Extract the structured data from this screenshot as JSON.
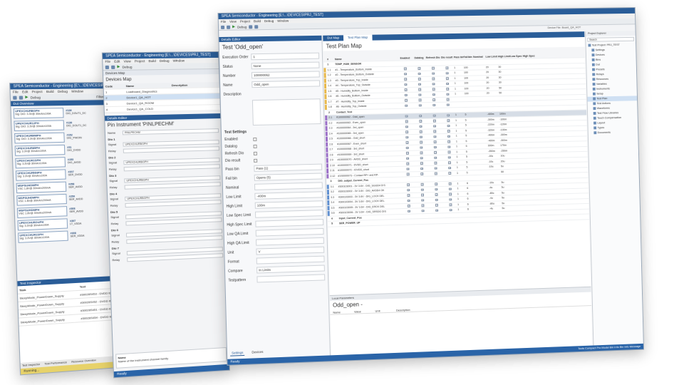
{
  "win1": {
    "title": "SPEA Semiconductor - Engineering [E:\\...\\DEVICES\\PRJ_TEST]",
    "menu": [
      "File",
      "Edit",
      "Project",
      "Build",
      "Debug",
      "Window"
    ],
    "debug_label": "Debug",
    "filter_label": "Filter For Active",
    "panel_title": "Dut Overview",
    "devices": [
      {
        "name": "UPEXCHURBGPH",
        "spec": "Sig: DIO: 3.3V@ 30mA/±100A",
        "pin": "#136",
        "pin_name": "DIG_DOUT1_DC"
      },
      {
        "name": "UPEXCHUR12PH",
        "spec": "Sig: DIO: 3.3V@ 30mA/±100A",
        "pin": "#136",
        "pin_name": "DIG_DOUT1_DC"
      },
      {
        "name": "UPEXCHURMMPH",
        "spec": "Sig: DIO: 3.3V@ 30mA/±100A",
        "pin": "#152",
        "pin_name": "DIG_PWOIN"
      },
      {
        "name": "UPEXCHUR85PH",
        "spec": "Sig: 3.3V@ 30mA/±100A",
        "pin": "#31",
        "pin_name": "DIG_DVDD"
      },
      {
        "name": "UPEXCHUR1SPH",
        "spec": "Sig: 3.3V@ 30mA/±100A",
        "pin": "#153",
        "pin_name": "DIG_AVDD"
      },
      {
        "name": "UPEXCHURNNPH",
        "spec": "Sig: 3.3V@ 30mA/±100A",
        "pin": "#207",
        "pin_name": "SER_DVDD"
      },
      {
        "name": "MSPSUHDMPH",
        "spec": "VSC 1.8V@ 30mA/±200mA",
        "pin": "#258",
        "pin_name": "SER_AVDD"
      },
      {
        "name": "MSPSUHDMPH",
        "spec": "VSC 1.8V@ 30mA/±200mA",
        "pin": "#259",
        "pin_name": "SER_AVDD"
      },
      {
        "name": "MSPSUHDMPH",
        "spec": "VSC 1.8V@ 30mA/±200mA",
        "pin": "#308",
        "pin_name": "SER_AVDD"
      },
      {
        "name": "UPEXCHURGUPH",
        "spec": "Sig: 3.3V@ 30mA/±100A",
        "pin": "#307",
        "pin_name": "LT_VDDA"
      },
      {
        "name": "UPEXCHUR1SPH",
        "spec": "Sig: 3.3V@ 30mA/±100A",
        "pin": "#308",
        "pin_name": "SER_VDDA"
      }
    ],
    "inspector_title": "Test Inspector",
    "inspector_cols": [
      "Task",
      "Test"
    ],
    "inspector_rows": [
      {
        "task": "SleepMode_PowerDown_Supply",
        "test": "#30028S453 - DVDD IDDC Ma..."
      },
      {
        "task": "SleepMode_PowerDown_Supply",
        "test": "#30028S452 - DVDD IDDC Ma..."
      },
      {
        "task": "SleepMode_PowerDown_Supply",
        "test": "#30028S451 - DVDD IDDC Ma..."
      },
      {
        "task": "SleepMode_PowerDown_Supply",
        "test": "#30028S454 - DVDD IDDC Ma..."
      }
    ],
    "bottom_tabs": [
      "Test Inspector",
      "Test Performance",
      "Resource Overview"
    ],
    "status": "Running..."
  },
  "win2": {
    "title": "SPEA Semiconductor - Engineering [E:\\...\\DEVICES\\PRJ_TEST]",
    "menu": [
      "File",
      "Edit",
      "View",
      "Project",
      "Build",
      "Debug",
      "Window"
    ],
    "debug_label": "Debug",
    "tab_label": "Devices Map",
    "map_title": "Devices Map",
    "map_cols": [
      "Code",
      "Name",
      "Description"
    ],
    "map_rows": [
      {
        "code": "1",
        "name": "Loadboard_Diagnostics",
        "desc": ""
      },
      {
        "code": "2",
        "name": "Device1_QA_HOT",
        "desc": ""
      },
      {
        "code": "3",
        "name": "Device1_QA_ROOM",
        "desc": ""
      },
      {
        "code": "4",
        "name": "Device1_QA_COLD",
        "desc": ""
      }
    ],
    "details_head": "Details Editor",
    "pin_title": "Pin Instrument 'PINLPECHM'",
    "name_label": "Name",
    "name_value": "PINLPECHM",
    "dios": [
      {
        "title": "Dio 1",
        "signal": "UPEXCHURBGPH",
        "relay": ""
      },
      {
        "title": "Dio 2",
        "signal": "UPEXCHURBGPH",
        "relay": ""
      },
      {
        "title": "Dio 3",
        "signal": "UPEXCHURBGPH",
        "relay": ""
      },
      {
        "title": "Dio 4",
        "signal": "UPEXCHURBGPH",
        "relay": ""
      },
      {
        "title": "Dio 5",
        "signal": "",
        "relay": ""
      },
      {
        "title": "Dio 6",
        "signal": "",
        "relay": ""
      },
      {
        "title": "Dio 7",
        "signal": "",
        "relay": ""
      },
      {
        "title": "Dio 8",
        "signal": "",
        "relay": ""
      },
      {
        "title": "Dio 9",
        "signal": "",
        "relay": ""
      }
    ],
    "signal_label": "Signal",
    "relay_label": "Relay",
    "desc_label": "Name",
    "desc_text": "Name of the instrument channel family",
    "status": "Ready"
  },
  "win3": {
    "title": "SPEA Semiconductor - Engineering [E:\\...\\DEVICES\\PRJ_TEST]",
    "menu": [
      "File",
      "View",
      "Project",
      "Build",
      "Debug",
      "Window"
    ],
    "debug_label": "Debug",
    "device_file": "Device File: Board_QA_HOT",
    "details_head": "Details Editor",
    "test_title": "Test 'Odd_open'",
    "fields": [
      {
        "label": "Execution Order",
        "value": "1"
      },
      {
        "label": "Status",
        "value": "None"
      },
      {
        "label": "Number",
        "value": "100000062"
      },
      {
        "label": "Name",
        "value": "Odd_open"
      },
      {
        "label": "Description",
        "value": ""
      }
    ],
    "settings_label": "Test Settings",
    "checks": [
      "Enabled",
      "Datalog",
      "Refresh Dio",
      "Dio result"
    ],
    "settings": [
      {
        "label": "Pass bin",
        "value": "Pass (1)"
      },
      {
        "label": "Fail bin",
        "value": "Opens (5)"
      },
      {
        "label": "Nominal",
        "value": ""
      },
      {
        "label": "Low Limit",
        "value": "-400m"
      },
      {
        "label": "High Limit",
        "value": "100m"
      },
      {
        "label": "Low Spec Limit",
        "value": ""
      },
      {
        "label": "High Spec Limit",
        "value": ""
      },
      {
        "label": "Low QA Limit",
        "value": ""
      },
      {
        "label": "High QA Limit",
        "value": ""
      },
      {
        "label": "Unit",
        "value": "V"
      },
      {
        "label": "Format",
        "value": ""
      },
      {
        "label": "Compare",
        "value": "In Limits"
      },
      {
        "label": "Testpattern",
        "value": ""
      }
    ],
    "det_tabs": [
      "Settings",
      "Devices"
    ],
    "doc_tabs": [
      "Dut Map",
      "Test Plan Map"
    ],
    "plan_title": "Test Plan Map",
    "grid_headers": [
      "#",
      "Name",
      "Enabled",
      "Datalog",
      "Refresh Dio",
      "Dio result",
      "Pass bin",
      "Fail bin",
      "Nominal",
      "Low Limit",
      "High Limit",
      "Low Spec Limit",
      "High Spec Limit"
    ],
    "grid_rows": [
      {
        "num": "1",
        "name": "TEMP_HUM_SENSOR",
        "group": true,
        "color": "",
        "vals": [
          "",
          "",
          "",
          "",
          ""
        ]
      },
      {
        "num": "1.1",
        "name": "#1 - Temperature_Bottom_Inside",
        "group": false,
        "color": "#e8b84a",
        "vals": [
          "1",
          "100",
          "",
          "20",
          "30"
        ]
      },
      {
        "num": "1.2",
        "name": "#2 - Temperature_Bottom_Outside",
        "group": false,
        "color": "#e8b84a",
        "vals": [
          "1",
          "100",
          "",
          "20",
          "30"
        ]
      },
      {
        "num": "1.3",
        "name": "#3 - Temperature_Top_Inside",
        "group": false,
        "color": "#e8b84a",
        "vals": [
          "1",
          "100",
          "",
          "20",
          "30"
        ]
      },
      {
        "num": "1.4",
        "name": "#4 - Temperature_Top_Outside",
        "group": false,
        "color": "#e8b84a",
        "vals": [
          "1",
          "100",
          "",
          "20",
          "30"
        ]
      },
      {
        "num": "1.5",
        "name": "#5 - Humidity_Bottom_Inside",
        "group": false,
        "color": "#e8b84a",
        "vals": [
          "1",
          "100",
          "",
          "20",
          "50"
        ]
      },
      {
        "num": "1.6",
        "name": "#6 - Humidity_Bottom_Outside",
        "group": false,
        "color": "#e8b84a",
        "vals": [
          "1",
          "100",
          "",
          "20",
          "50"
        ]
      },
      {
        "num": "1.7",
        "name": "#7 - Humidity_Top_Inside",
        "group": false,
        "color": "#e8b84a",
        "vals": [
          "",
          "",
          "",
          "",
          ""
        ]
      },
      {
        "num": "1.8",
        "name": "#8 - Humidity_Top_Outside",
        "group": false,
        "color": "#e8b84a",
        "vals": [
          "",
          "",
          "",
          "",
          ""
        ]
      },
      {
        "num": "2",
        "name": "Contact_Test",
        "group": true,
        "color": "",
        "vals": [
          "",
          "",
          "",
          "",
          ""
        ]
      },
      {
        "num": "2.1",
        "name": "#100000062 - Odd_open",
        "group": false,
        "color": "#9b6fc7",
        "sel": true,
        "vals": [
          "1",
          "5",
          "",
          "-400m",
          "100m"
        ]
      },
      {
        "num": "2.2",
        "name": "#100000063 - Even_open",
        "group": false,
        "color": "#9b6fc7",
        "vals": [
          "1",
          "5",
          "",
          "-300m",
          "-100m"
        ]
      },
      {
        "num": "2.3",
        "name": "#100000064 - 3rd_open",
        "group": false,
        "color": "#9b6fc7",
        "vals": [
          "1",
          "5",
          "",
          "-220m",
          "-120m"
        ]
      },
      {
        "num": "2.4",
        "name": "#100000065 - 3rd_open",
        "group": false,
        "color": "#9b6fc7",
        "vals": [
          "1",
          "5",
          "",
          "-320m",
          "-100m"
        ]
      },
      {
        "num": "2.5",
        "name": "#100000066 - Odd_short",
        "group": false,
        "color": "#9b6fc7",
        "vals": [
          "1",
          "5",
          "",
          "-400m",
          "-300m"
        ]
      },
      {
        "num": "2.6",
        "name": "#100000067 - Even_short",
        "group": false,
        "color": "#9b6fc7",
        "vals": [
          "1",
          "5",
          "",
          "-400m",
          "-300m"
        ]
      },
      {
        "num": "2.7",
        "name": "#100000068 - 3rd_short",
        "group": false,
        "color": "#9b6fc7",
        "vals": [
          "1",
          "5",
          "",
          "300m",
          "170m"
        ]
      },
      {
        "num": "2.8",
        "name": "#100000069 - 3rd_short",
        "group": false,
        "color": "#9b6fc7",
        "vals": [
          "1",
          "5",
          "",
          "-350m",
          "-250m"
        ]
      },
      {
        "num": "2.9",
        "name": "#100000070 - AVDD_short",
        "group": false,
        "color": "#9b6fc7",
        "vals": [
          "1",
          "5",
          "",
          "-10u",
          "10u"
        ]
      },
      {
        "num": "2.10",
        "name": "#100000071 - DVDD_short",
        "group": false,
        "color": "#9b6fc7",
        "vals": [
          "1",
          "5",
          "",
          "-10u",
          "20u"
        ]
      },
      {
        "num": "2.11",
        "name": "#100000072 - IOVDD_short",
        "group": false,
        "color": "#9b6fc7",
        "vals": [
          "1",
          "5",
          "",
          "-10u",
          "5u"
        ]
      },
      {
        "num": "2.12",
        "name": "#100000073 - Contact RP+ and RP-",
        "group": false,
        "color": "#9b6fc7",
        "vals": [
          "1",
          "5",
          "",
          "",
          "50"
        ]
      },
      {
        "num": "3",
        "name": "DIG_output_Current_Pos",
        "group": true,
        "color": "",
        "vals": [
          "",
          "",
          "",
          "",
          ""
        ]
      },
      {
        "num": "3.1",
        "name": "#300103001 - 3V 3.6V - DIG_SGGD4 DIS",
        "group": false,
        "color": "#5f8fd0",
        "vals": [
          "1",
          "6",
          "",
          "-10u",
          "5u"
        ]
      },
      {
        "num": "3.2",
        "name": "#300103002 - 3V 3.6V - DIG_AVDD4 OK",
        "group": false,
        "color": "#5f8fd0",
        "vals": [
          "1",
          "6",
          "",
          "-4u",
          "5u"
        ]
      },
      {
        "num": "3.3",
        "name": "#300103003 - 3V 3.6V - DIG_LOCK DEL",
        "group": false,
        "color": "#5f8fd0",
        "vals": [
          "1",
          "6",
          "",
          "-80u",
          "5u"
        ]
      },
      {
        "num": "3.4",
        "name": "#300103004 - 3V 3.6V - DIG_LOCK DEL",
        "group": false,
        "color": "#5f8fd0",
        "vals": [
          "1",
          "6",
          "",
          "-4u",
          "5u"
        ]
      },
      {
        "num": "3.5",
        "name": "#300103005 - 3V 3.6V - DIG_ERCK DEL",
        "group": false,
        "color": "#5f8fd0",
        "vals": [
          "1",
          "6",
          "",
          "-80u",
          "5u"
        ]
      },
      {
        "num": "3.6",
        "name": "#300103006 - 3V 3.6V - DIG_SRSDG DIS",
        "group": false,
        "color": "#5f8fd0",
        "vals": [
          "1",
          "6",
          "",
          "-4u",
          "5u"
        ]
      },
      {
        "num": "4",
        "name": "Input_Current_Pos",
        "group": true,
        "color": "",
        "vals": [
          "",
          "",
          "",
          "",
          ""
        ]
      },
      {
        "num": "5",
        "name": "SER_POWER_UP",
        "group": true,
        "color": "",
        "vals": [
          "",
          "",
          "",
          "",
          ""
        ]
      }
    ],
    "local_params_head": "Local Parameters",
    "local_title": "Odd_open -",
    "local_cols": [
      "Name",
      "Value",
      "Unit",
      "Description"
    ],
    "explorer_head": "Project Explorer",
    "explorer_search": "Search",
    "explorer_items": [
      {
        "label": "Test Project: PRJ_TEST",
        "sub": false,
        "sel": false
      },
      {
        "label": "Settings",
        "sub": true,
        "sel": false
      },
      {
        "label": "Devices",
        "sub": true,
        "sel": false
      },
      {
        "label": "Bins",
        "sub": true,
        "sel": false
      },
      {
        "label": "Dut",
        "sub": true,
        "sel": false
      },
      {
        "label": "Presets",
        "sub": true,
        "sel": false
      },
      {
        "label": "Relays",
        "sub": true,
        "sel": false
      },
      {
        "label": "Resources",
        "sub": true,
        "sel": false
      },
      {
        "label": "Variables",
        "sub": true,
        "sel": false
      },
      {
        "label": "Instruments",
        "sub": true,
        "sel": false
      },
      {
        "label": "Setup",
        "sub": true,
        "sel": false
      },
      {
        "label": "Test Plan",
        "sub": true,
        "sel": true
      },
      {
        "label": "Test Actions",
        "sub": true,
        "sel": false
      },
      {
        "label": "Waveforms",
        "sub": true,
        "sel": false
      },
      {
        "label": "Test Flow Libraries",
        "sub": true,
        "sel": false
      },
      {
        "label": "Touch Compensation",
        "sub": true,
        "sel": false
      },
      {
        "label": "Layout",
        "sub": true,
        "sel": false
      },
      {
        "label": "Types",
        "sub": true,
        "sel": false
      },
      {
        "label": "Documents",
        "sub": true,
        "sel": false
      }
    ],
    "status": "Ready",
    "status_right": "Tools   Compact Pro Model   Bin Info   Bin Info Message"
  }
}
